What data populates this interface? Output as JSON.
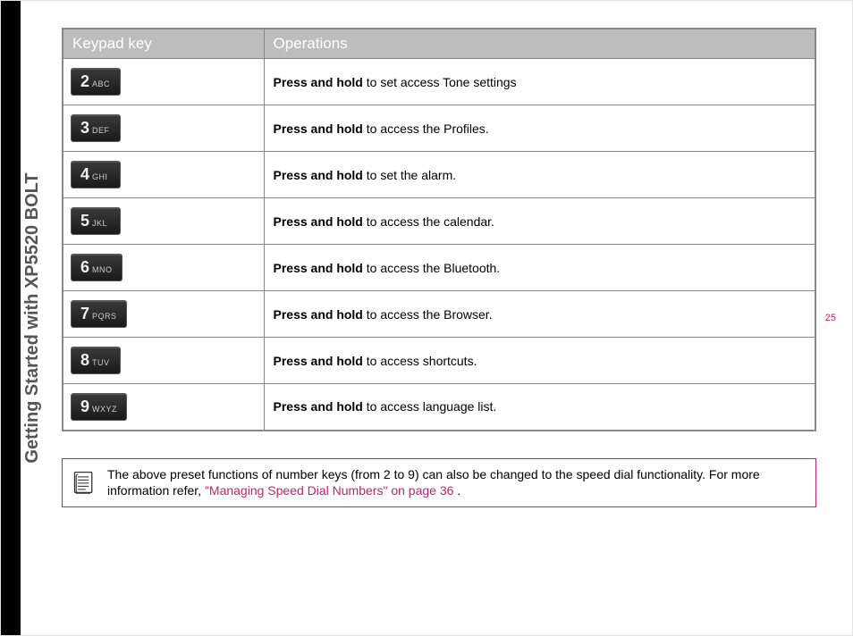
{
  "sideLabel": "Getting Started with XP5520 BOLT",
  "pageNumber": "25",
  "table": {
    "headers": {
      "key": "Keypad key",
      "ops": "Operations"
    },
    "rows": [
      {
        "digit": "2",
        "letters": "ABC",
        "bold": "Press and hold",
        "rest": " to set access Tone settings"
      },
      {
        "digit": "3",
        "letters": "DEF",
        "bold": "Press and hold",
        "rest": " to access the Profiles."
      },
      {
        "digit": "4",
        "letters": "GHI",
        "bold": "Press and hold",
        "rest": " to set the alarm."
      },
      {
        "digit": "5",
        "letters": "JKL",
        "bold": "Press and hold",
        "rest": " to access the calendar."
      },
      {
        "digit": "6",
        "letters": "MNO",
        "bold": "Press and hold",
        "rest": " to access the Bluetooth."
      },
      {
        "digit": "7",
        "letters": "PQRS",
        "bold": "Press and hold",
        "rest": " to access the Browser."
      },
      {
        "digit": "8",
        "letters": "TUV",
        "bold": "Press and hold",
        "rest": " to access shortcuts."
      },
      {
        "digit": "9",
        "letters": "WXYZ",
        "bold": "Press and hold",
        "rest": " to access language list."
      }
    ]
  },
  "note": {
    "pre": "The above preset functions of number keys (from 2 to 9) can also be changed to the speed dial functionality. For more information refer, ",
    "link": "\"Managing Speed Dial Numbers\" on page 36",
    "post": " ."
  }
}
